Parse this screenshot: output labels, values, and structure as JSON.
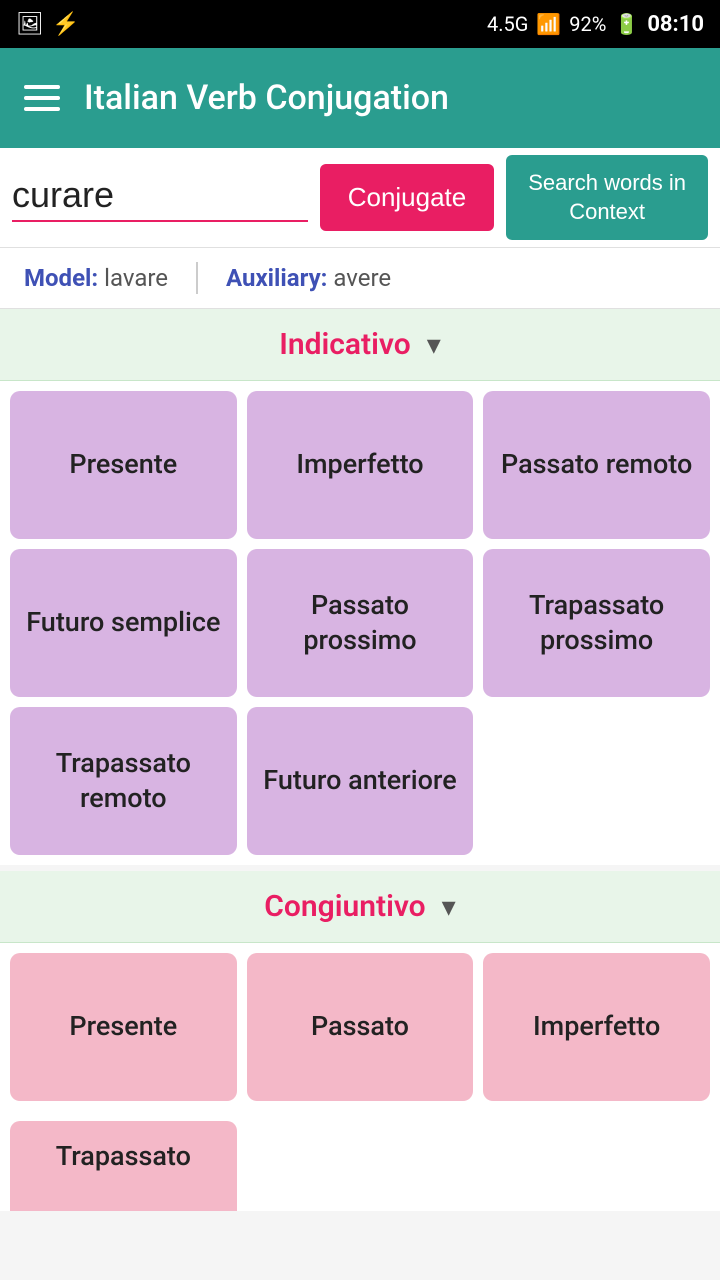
{
  "statusBar": {
    "signal": "4.5G",
    "battery": "92%",
    "time": "08:10",
    "icons": [
      "photo-icon",
      "flash-icon"
    ]
  },
  "appBar": {
    "title": "Italian Verb Conjugation",
    "menuIcon": "menu-icon"
  },
  "searchBar": {
    "inputValue": "curare",
    "inputPlaceholder": "",
    "conjugateLabel": "Conjugate",
    "contextLabel": "Search words in\nContext"
  },
  "modelRow": {
    "modelLabel": "Model:",
    "modelValue": "lavare",
    "auxiliaryLabel": "Auxiliary:",
    "auxiliaryValue": "avere"
  },
  "indicativo": {
    "sectionTitle": "Indicativo",
    "chevron": "▾",
    "tenses": [
      {
        "label": "Presente",
        "type": "purple"
      },
      {
        "label": "Imperfetto",
        "type": "purple"
      },
      {
        "label": "Passato remoto",
        "type": "purple"
      },
      {
        "label": "Futuro semplice",
        "type": "purple"
      },
      {
        "label": "Passato prossimo",
        "type": "purple"
      },
      {
        "label": "Trapassato prossimo",
        "type": "purple"
      },
      {
        "label": "Trapassato remoto",
        "type": "purple"
      },
      {
        "label": "Futuro anteriore",
        "type": "purple"
      },
      {
        "label": "",
        "type": "empty"
      }
    ]
  },
  "congiuntivo": {
    "sectionTitle": "Congiuntivo",
    "chevron": "▾",
    "tenses": [
      {
        "label": "Presente",
        "type": "pink"
      },
      {
        "label": "Passato",
        "type": "pink"
      },
      {
        "label": "Imperfetto",
        "type": "pink"
      }
    ],
    "partialTenses": [
      {
        "label": "Trapassato",
        "type": "pink"
      }
    ]
  }
}
